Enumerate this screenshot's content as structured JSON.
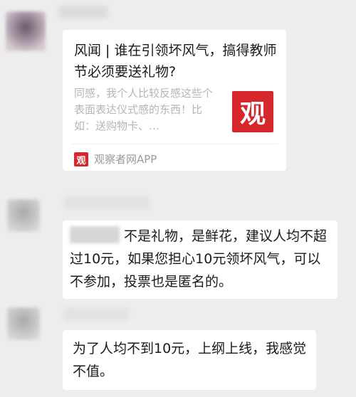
{
  "link_card": {
    "title": "风闻 | 谁在引领坏风气，搞得教师节必须要送礼物?",
    "description": "同感，我个人比较反感这些个表面表达仪式感的东西！比如：送购物卡、…",
    "thumb_glyph": "观",
    "source_icon_glyph": "观",
    "source": "观察者网APP",
    "accent_color": "#d5272c"
  },
  "messages": [
    {
      "text": "不是礼物，是鲜花，建议人均不超过10元，如果您担心10元领坏风气，可以不参加，投票也是匿名的。"
    },
    {
      "text": "为了人均不到10元，上纲上线，我感觉不值。"
    }
  ]
}
